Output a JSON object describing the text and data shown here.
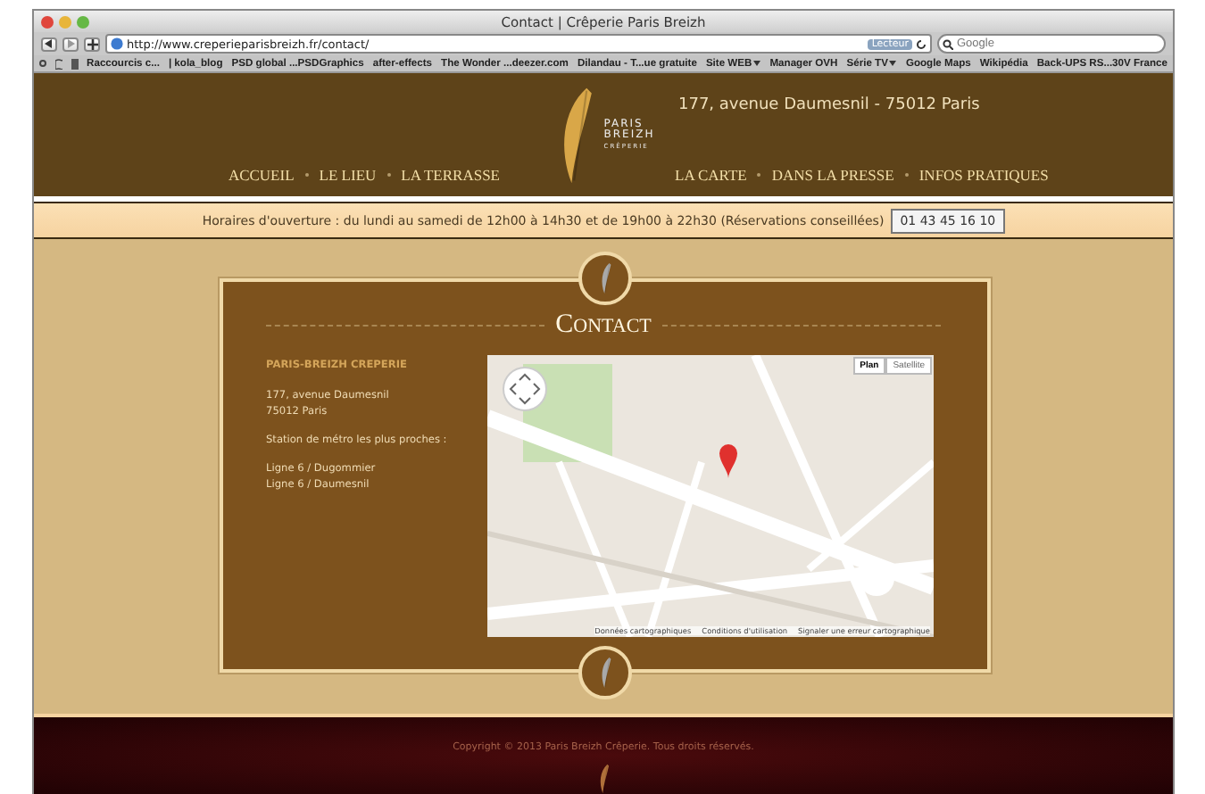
{
  "window": {
    "title": "Contact | Crêperie Paris Breizh"
  },
  "toolbar": {
    "address": "http://www.creperieparisbreizh.fr/contact/",
    "reader_badge": "Lecteur",
    "search": {
      "placeholder": "Google"
    }
  },
  "bookmarks": [
    {
      "label": "Raccourcis c...",
      "menu": false
    },
    {
      "label": "| kola_blog",
      "menu": false
    },
    {
      "label": "PSD global ...PSDGraphics",
      "menu": false
    },
    {
      "label": "after-effects",
      "menu": false
    },
    {
      "label": "The Wonder ...deezer.com",
      "menu": false
    },
    {
      "label": "Dilandau - T...ue gratuite",
      "menu": false
    },
    {
      "label": "Site WEB",
      "menu": true
    },
    {
      "label": "Manager OVH",
      "menu": false
    },
    {
      "label": "Série TV",
      "menu": true
    },
    {
      "label": "Google Maps",
      "menu": false
    },
    {
      "label": "Wikipédia",
      "menu": false
    },
    {
      "label": "Back-UPS RS...30V France",
      "menu": false
    }
  ],
  "header": {
    "address": "177, avenue Daumesnil - 75012 Paris",
    "logo_text": [
      "PARIS",
      "BREIZH",
      "CRÊPERIE"
    ],
    "nav_left": [
      "ACCUEIL",
      "LE LIEU",
      "LA TERRASSE"
    ],
    "nav_right": [
      "LA CARTE",
      "DANS LA PRESSE",
      "INFOS PRATIQUES"
    ]
  },
  "hours_bar": {
    "text": "Horaires d'ouverture : du lundi au samedi de 12h00 à 14h30 et de 19h00 à 22h30 (Réservations conseillées)",
    "phone": "01 43 45 16 10"
  },
  "contact": {
    "title": "Contact",
    "name": "PARIS-BREIZH CREPERIE",
    "address_lines": [
      "177, avenue Daumesnil",
      "75012 Paris"
    ],
    "metro_heading": "Station de métro les plus proches :",
    "metro_lines": [
      "Ligne 6 / Dugommier",
      "Ligne 6 / Daumesnil"
    ],
    "map": {
      "types": [
        {
          "label": "Plan",
          "selected": true
        },
        {
          "label": "Satellite",
          "selected": false
        }
      ],
      "attribution": [
        "Données cartographiques",
        "Conditions d'utilisation",
        "Signaler une erreur cartographique"
      ]
    }
  },
  "footer": {
    "copyright": "Copyright © 2013 Paris Breizh Crêperie. Tous droits réservés."
  }
}
